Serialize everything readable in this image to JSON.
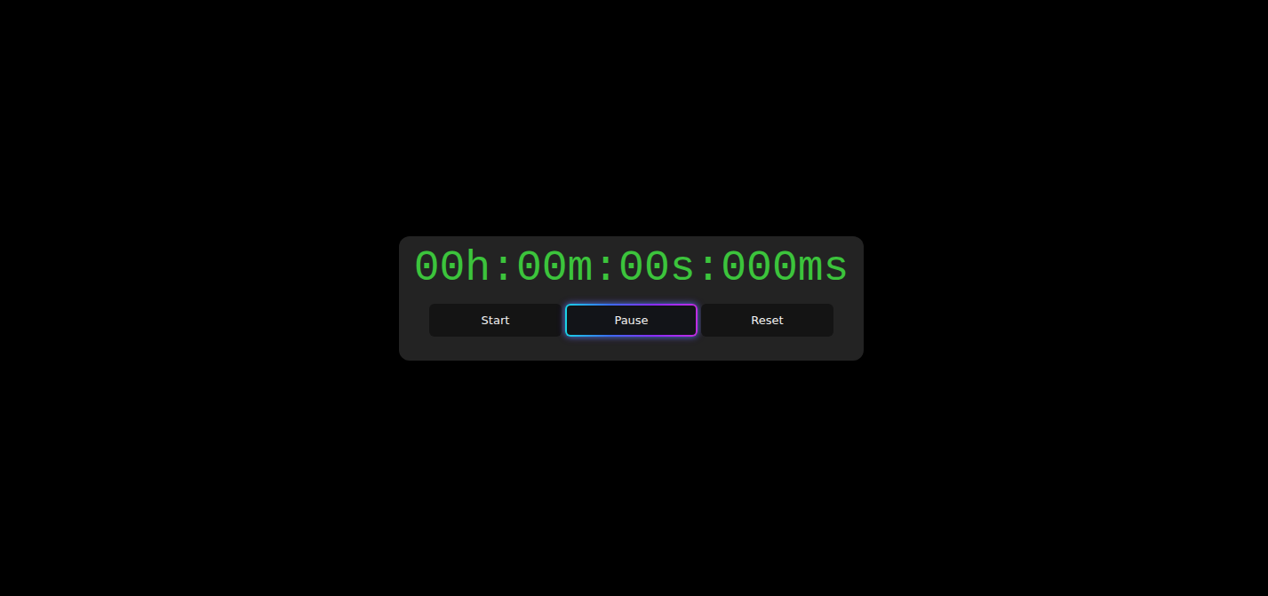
{
  "timer": {
    "display": "00h:00m:00s:000ms"
  },
  "buttons": [
    {
      "label": "Start",
      "selected": false
    },
    {
      "label": "Pause",
      "selected": true
    },
    {
      "label": "Reset",
      "selected": false
    }
  ]
}
